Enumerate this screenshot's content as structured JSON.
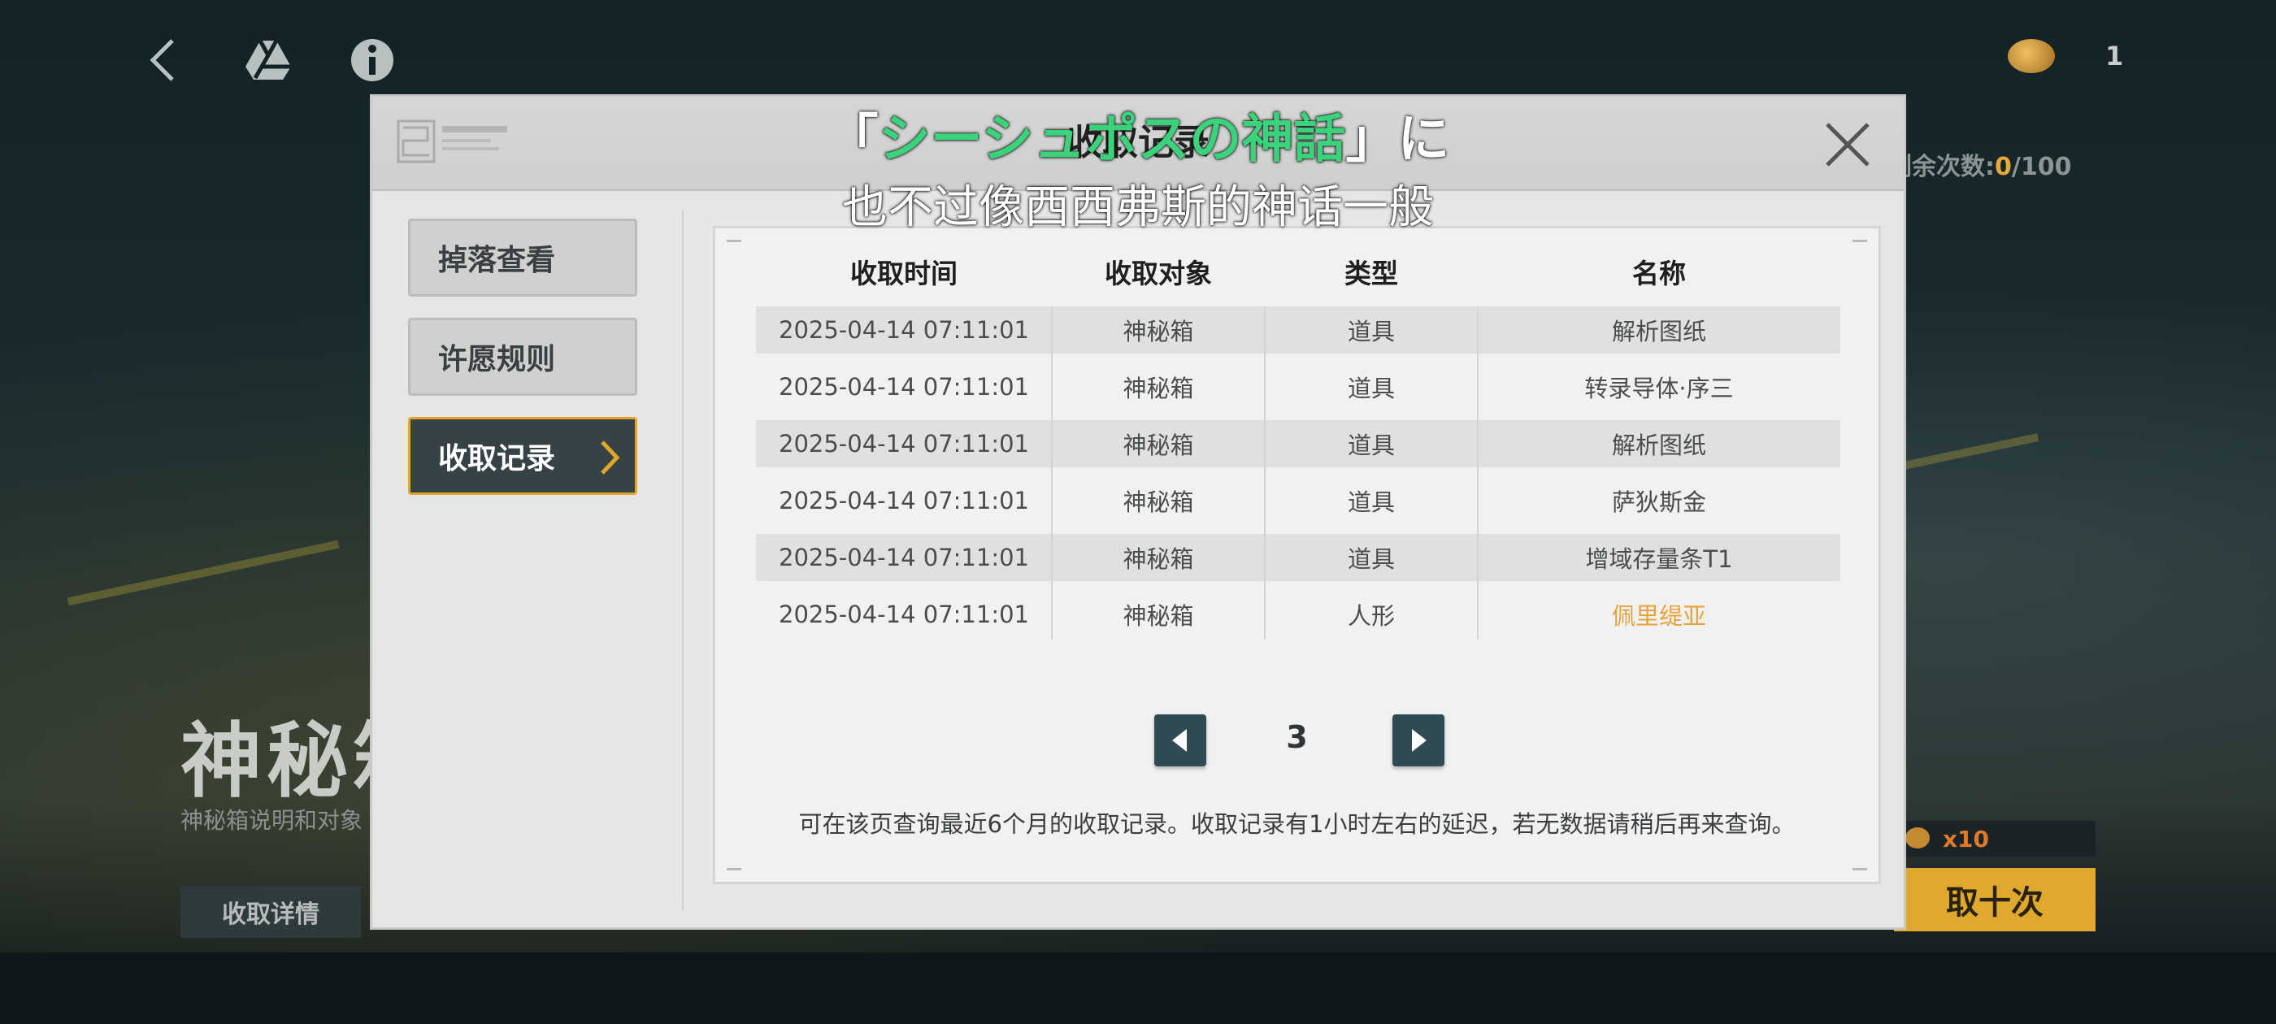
{
  "top_bar": {
    "currency_count": "1",
    "remaining_label": "剩余次数:",
    "remaining_value": "0",
    "remaining_total": "/100"
  },
  "background": {
    "title": "神秘箱",
    "subtitle": "神秘箱说明和对象",
    "detail_button": "收取详情",
    "ten_pull_button": "取十次",
    "cost_multiplier": "x10"
  },
  "modal": {
    "title": "收取记录",
    "sidebar": [
      {
        "label": "掉落查看",
        "active": false
      },
      {
        "label": "许愿规则",
        "active": false
      },
      {
        "label": "收取记录",
        "active": true
      }
    ],
    "table": {
      "headers": [
        "收取时间",
        "收取对象",
        "类型",
        "名称"
      ],
      "rows": [
        [
          "2025-04-14 07:11:01",
          "神秘箱",
          "道具",
          "解析图纸"
        ],
        [
          "2025-04-14 07:11:01",
          "神秘箱",
          "道具",
          "转录导体·序三"
        ],
        [
          "2025-04-14 07:11:01",
          "神秘箱",
          "道具",
          "解析图纸"
        ],
        [
          "2025-04-14 07:11:01",
          "神秘箱",
          "道具",
          "萨狄斯金"
        ],
        [
          "2025-04-14 07:11:01",
          "神秘箱",
          "道具",
          "增域存量条T1"
        ],
        [
          "2025-04-14 07:11:01",
          "神秘箱",
          "人形",
          "佩里缇亚"
        ]
      ],
      "highlight_color": "#e6a33a"
    },
    "page_number": "3",
    "note": "可在该页查询最近6个月的收取记录。收取记录有1小时左右的延迟，若无数据请稍后再来查询。"
  },
  "subtitles": {
    "jp_open": "「",
    "jp_green": "シーシュポスの神話",
    "jp_close": "」に",
    "cn": "也不过像西西弗斯的神话一般"
  }
}
